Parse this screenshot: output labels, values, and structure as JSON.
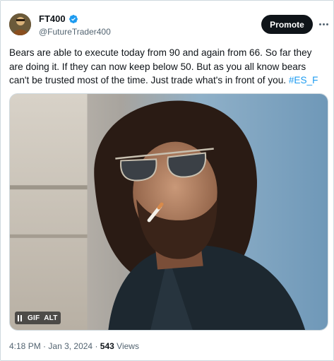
{
  "author": {
    "display_name": "FT400",
    "handle": "@FutureTrader400",
    "verified": true,
    "verified_color": "#1d9bf0"
  },
  "actions": {
    "promote_label": "Promote",
    "more_icon": "more-horizontal-icon"
  },
  "tweet": {
    "lines": [
      "Bears are able to execute today from 90 and again from 66. So far they",
      "are doing it. If they can now keep below 50. But as you all know bears"
    ],
    "last_line_text": "can't be trusted most of the time. Just trade what's in front of you. ",
    "hashtag": "#ES_F",
    "hashtag_color": "#1d9bf0"
  },
  "media": {
    "type": "gif",
    "pause_icon": "pause-icon",
    "gif_label": "GIF",
    "alt_label": "ALT"
  },
  "meta": {
    "time": "4:18 PM",
    "separator": "·",
    "date": "Jan 3, 2024",
    "views_count": "543",
    "views_label": "Views"
  },
  "colors": {
    "text_primary": "#0f1419",
    "text_secondary": "#536471",
    "promote_bg": "#0f1419",
    "border": "#cfd9de"
  }
}
